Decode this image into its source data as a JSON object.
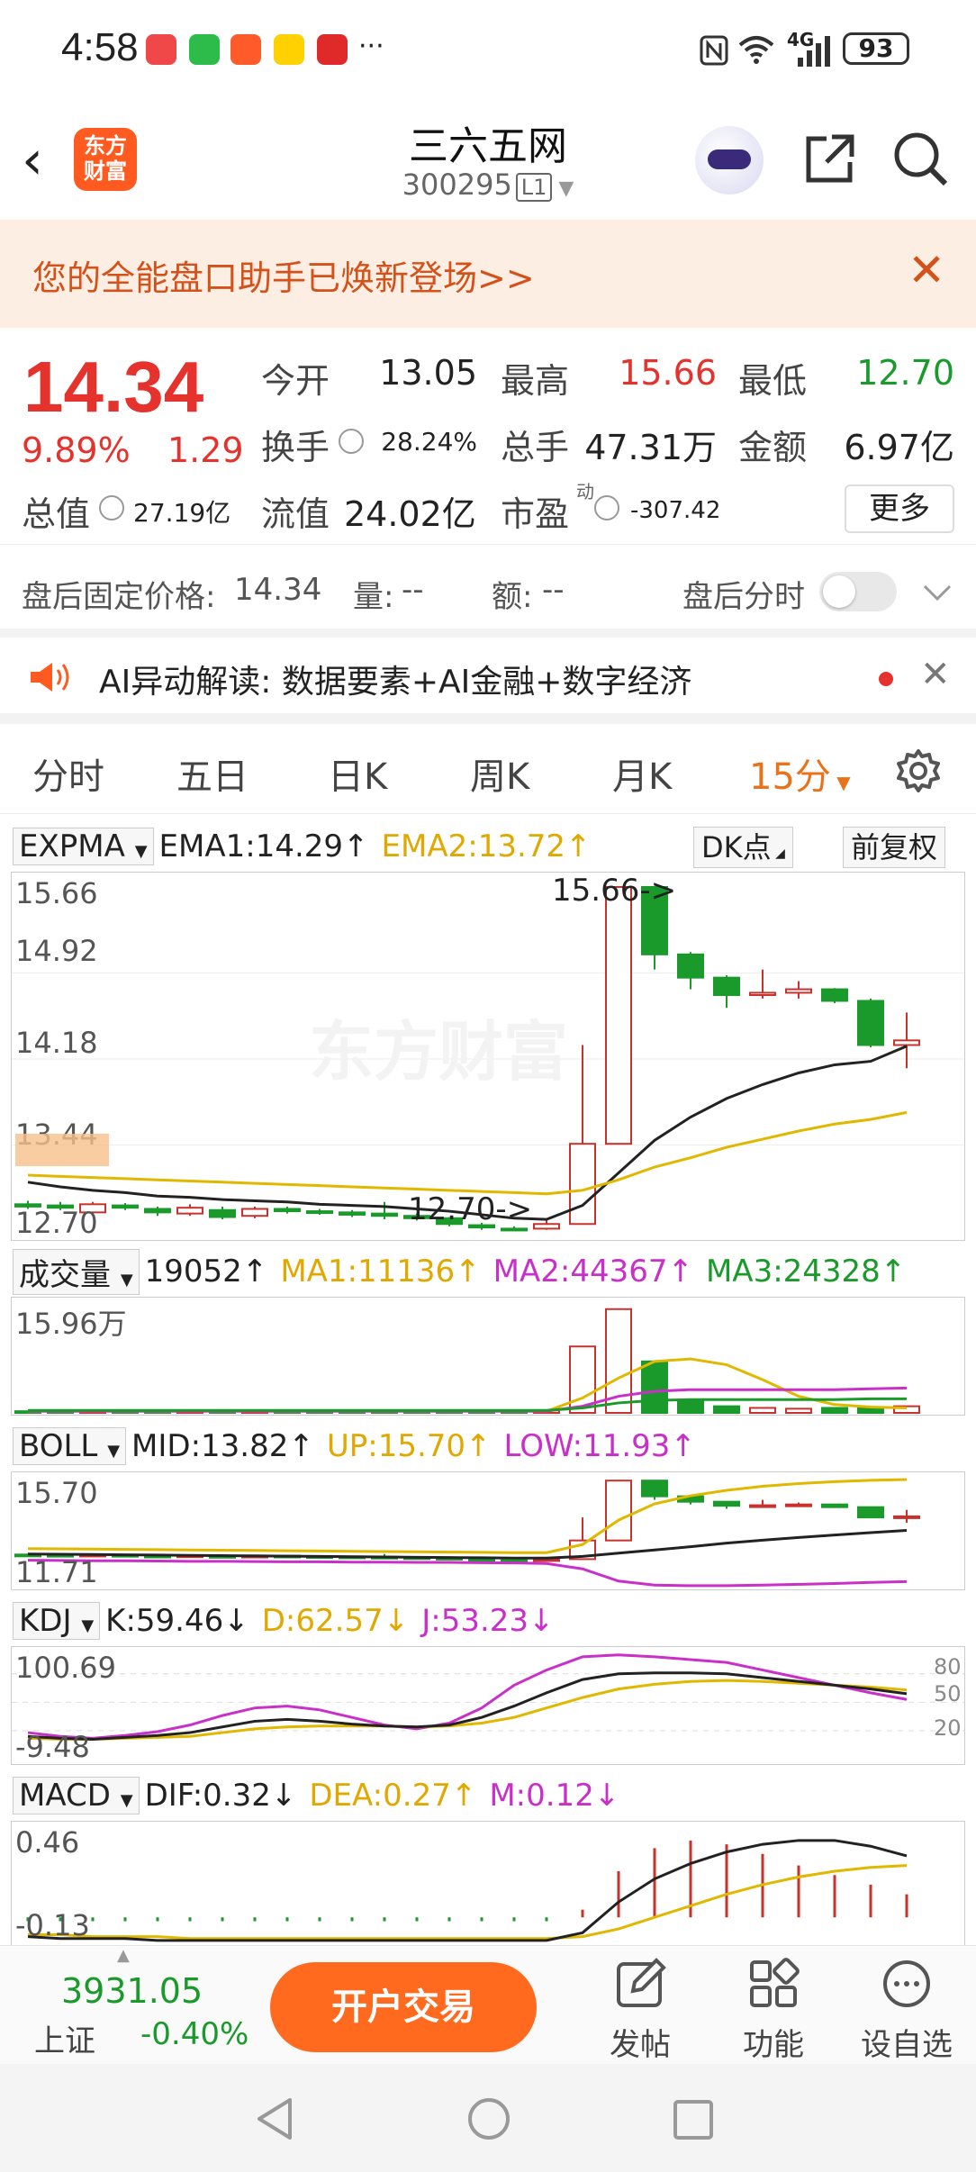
{
  "status_bar": {
    "time": "4:58",
    "more": "···",
    "battery": "93",
    "network": "4G"
  },
  "header": {
    "back": "‹",
    "logo_text": "东方财富",
    "title": "三六五网",
    "code": "300295",
    "level": "L1"
  },
  "banner": {
    "text": "您的全能盘口助手已焕新登场>>",
    "close": "✕"
  },
  "quote": {
    "price": "14.34",
    "change_pct": "9.89%",
    "change": "1.29",
    "open_label": "今开",
    "open": "13.05",
    "high_label": "最高",
    "high": "15.66",
    "low_label": "最低",
    "low": "12.70",
    "turnover_label": "换手",
    "turnover": "28.24%",
    "volume_label": "总手",
    "volume": "47.31万",
    "amount_label": "金额",
    "amount": "6.97亿",
    "mktcap_label": "总值",
    "mktcap": "27.19亿",
    "float_label": "流值",
    "float": "24.02亿",
    "pe_label": "市盈",
    "pe_sup": "动",
    "pe": "-307.42",
    "more": "更多"
  },
  "after_hours": {
    "price_label": "盘后固定价格:",
    "price": "14.34",
    "vol_label": "量:",
    "vol": "--",
    "amt_label": "额:",
    "amt": "--",
    "timeshare": "盘后分时"
  },
  "ai_bar": {
    "text": "AI异动解读:  数据要素+AI金融+数字经济",
    "close": "✕"
  },
  "tabs": [
    "分时",
    "五日",
    "日K",
    "周K",
    "月K",
    "15分"
  ],
  "tab_active": "15分",
  "indicators": {
    "main": {
      "name": "EXPMA",
      "l1": "EMA1:14.29↑",
      "l2": "EMA2:13.72↑",
      "dk": "DK点",
      "fq": "前复权",
      "axis_top": "15.66",
      "axis_2": "14.92",
      "axis_3": "14.18",
      "axis_4": "13.44",
      "axis_bot": "12.70",
      "high_mark": "15.66->",
      "low_mark": "12.70->",
      "watermark": "东方财富"
    },
    "vol": {
      "name": "成交量",
      "v": "19052↑",
      "ma1": "MA1:11136↑",
      "ma2": "MA2:44367↑",
      "ma3": "MA3:24328↑",
      "axis_top": "15.96万"
    },
    "boll": {
      "name": "BOLL",
      "mid": "MID:13.82↑",
      "up": "UP:15.70↑",
      "low": "LOW:11.93↑",
      "axis_top": "15.70",
      "axis_bot": "11.71"
    },
    "kdj": {
      "name": "KDJ",
      "k": "K:59.46↓",
      "d": "D:62.57↓",
      "j": "J:53.23↓",
      "axis_top": "100.69",
      "axis_bot": "-9.48",
      "r80": "80",
      "r50": "50",
      "r20": "20"
    },
    "macd": {
      "name": "MACD",
      "dif": "DIF:0.32↓",
      "dea": "DEA:0.27↑",
      "m": "M:0.12↓",
      "axis_top": "0.46",
      "axis_bot": "-0.13"
    }
  },
  "chart_data": {
    "type": "candlestick",
    "candles": [
      {
        "o": 12.93,
        "c": 12.91,
        "h": 12.96,
        "l": 12.89
      },
      {
        "o": 12.92,
        "c": 12.9,
        "h": 12.95,
        "l": 12.88
      },
      {
        "o": 12.86,
        "c": 12.93,
        "h": 12.95,
        "l": 12.84
      },
      {
        "o": 12.92,
        "c": 12.9,
        "h": 12.94,
        "l": 12.88
      },
      {
        "o": 12.89,
        "c": 12.86,
        "h": 12.91,
        "l": 12.83
      },
      {
        "o": 12.85,
        "c": 12.9,
        "h": 12.93,
        "l": 12.83
      },
      {
        "o": 12.88,
        "c": 12.82,
        "h": 12.91,
        "l": 12.8
      },
      {
        "o": 12.83,
        "c": 12.89,
        "h": 12.91,
        "l": 12.81
      },
      {
        "o": 12.89,
        "c": 12.87,
        "h": 12.91,
        "l": 12.85
      },
      {
        "o": 12.87,
        "c": 12.86,
        "h": 12.89,
        "l": 12.84
      },
      {
        "o": 12.86,
        "c": 12.84,
        "h": 12.88,
        "l": 12.82
      },
      {
        "o": 12.85,
        "c": 12.83,
        "h": 12.95,
        "l": 12.8
      },
      {
        "o": 12.83,
        "c": 12.81,
        "h": 12.85,
        "l": 12.79
      },
      {
        "o": 12.81,
        "c": 12.76,
        "h": 12.82,
        "l": 12.74
      },
      {
        "o": 12.75,
        "c": 12.73,
        "h": 12.77,
        "l": 12.71
      },
      {
        "o": 12.72,
        "c": 12.71,
        "h": 12.74,
        "l": 12.7
      },
      {
        "o": 12.72,
        "c": 12.76,
        "h": 12.79,
        "l": 12.71
      },
      {
        "o": 12.76,
        "c": 13.45,
        "h": 14.3,
        "l": 12.76
      },
      {
        "o": 13.45,
        "c": 15.66,
        "h": 15.66,
        "l": 13.45
      },
      {
        "o": 15.66,
        "c": 15.08,
        "h": 15.66,
        "l": 14.95
      },
      {
        "o": 15.08,
        "c": 14.88,
        "h": 15.1,
        "l": 14.78
      },
      {
        "o": 14.88,
        "c": 14.73,
        "h": 14.9,
        "l": 14.62
      },
      {
        "o": 14.73,
        "c": 14.75,
        "h": 14.95,
        "l": 14.7
      },
      {
        "o": 14.75,
        "c": 14.78,
        "h": 14.85,
        "l": 14.7
      },
      {
        "o": 14.78,
        "c": 14.68,
        "h": 14.79,
        "l": 14.66
      },
      {
        "o": 14.68,
        "c": 14.3,
        "h": 14.7,
        "l": 14.28
      },
      {
        "o": 14.3,
        "c": 14.34,
        "h": 14.58,
        "l": 14.1
      }
    ],
    "ema1": [
      13.12,
      13.08,
      13.05,
      13.03,
      13.0,
      12.99,
      12.97,
      12.96,
      12.95,
      12.93,
      12.92,
      12.91,
      12.89,
      12.87,
      12.84,
      12.81,
      12.8,
      12.92,
      13.2,
      13.48,
      13.68,
      13.84,
      13.96,
      14.06,
      14.13,
      14.16,
      14.29
    ],
    "ema2": [
      13.18,
      13.17,
      13.16,
      13.15,
      13.14,
      13.13,
      13.12,
      13.11,
      13.1,
      13.09,
      13.08,
      13.07,
      13.06,
      13.05,
      13.04,
      13.03,
      13.02,
      13.05,
      13.14,
      13.25,
      13.33,
      13.42,
      13.49,
      13.56,
      13.62,
      13.66,
      13.72
    ],
    "ylim": [
      12.7,
      15.66
    ],
    "x_axis": "15分钟"
  },
  "bottom": {
    "index_value": "3931.05",
    "index_name": "上证",
    "index_change": "-0.40%",
    "trade": "开户交易",
    "post": "发帖",
    "func": "功能",
    "custom": "设自选"
  }
}
